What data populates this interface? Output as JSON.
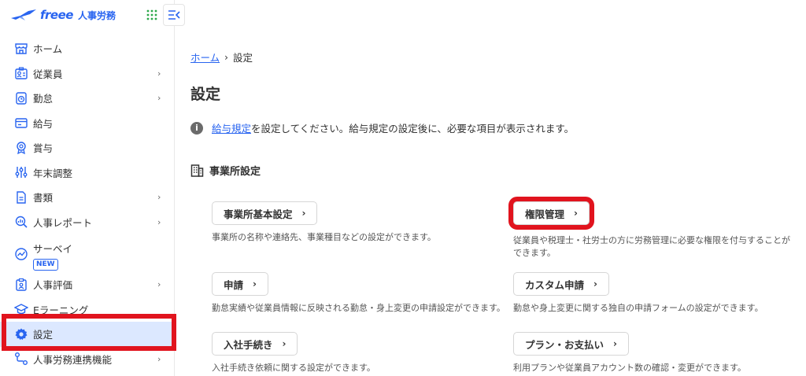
{
  "logo": {
    "brand": "freee",
    "product": "人事労務"
  },
  "sidebar": {
    "items": [
      {
        "label": "ホーム",
        "icon": "storefront-icon",
        "chevron": ""
      },
      {
        "label": "従業員",
        "icon": "employee-id-icon",
        "chevron": "›"
      },
      {
        "label": "勤怠",
        "icon": "clock-icon",
        "chevron": "›"
      },
      {
        "label": "給与",
        "icon": "wallet-icon",
        "chevron": ""
      },
      {
        "label": "賞与",
        "icon": "award-icon",
        "chevron": ""
      },
      {
        "label": "年末調整",
        "icon": "adjust-icon",
        "chevron": ""
      },
      {
        "label": "書類",
        "icon": "document-icon",
        "chevron": "›"
      },
      {
        "label": "人事レポート",
        "icon": "report-icon",
        "chevron": "›"
      },
      {
        "label": "サーベイ",
        "icon": "survey-icon",
        "chevron": "",
        "badge": "NEW"
      },
      {
        "label": "人事評価",
        "icon": "evaluation-icon",
        "chevron": "›"
      },
      {
        "label": "Eラーニング",
        "icon": "graduation-icon",
        "chevron": ""
      },
      {
        "label": "設定",
        "icon": "gear-icon",
        "chevron": ""
      },
      {
        "label": "人事労務連携機能",
        "icon": "integration-icon",
        "chevron": "›"
      }
    ]
  },
  "breadcrumb": {
    "home": "ホーム",
    "sep": "›",
    "current": "設定"
  },
  "page": {
    "title": "設定"
  },
  "notice": {
    "link": "給与規定",
    "text": "を設定してください。給与規定の設定後に、必要な項目が表示されます。"
  },
  "section": {
    "title": "事業所設定"
  },
  "cards": [
    {
      "label": "事業所基本設定",
      "desc": "事業所の名称や連絡先、事業種目などの設定ができます。"
    },
    {
      "label": "権限管理",
      "desc": "従業員や税理士・社労士の方に労務管理に必要な権限を付与することができます。"
    },
    {
      "label": "申請",
      "desc": "勤怠実績や従業員情報に反映される勤怠・身上変更の申請設定ができます。"
    },
    {
      "label": "カスタム申請",
      "desc": "勤怠や身上変更に関する独自の申請フォームの設定ができます。"
    },
    {
      "label": "入社手続き",
      "desc": "入社手続き依頼に関する設定ができます。"
    },
    {
      "label": "プラン・お支払い",
      "desc": "利用プランや従業員アカウント数の確認・変更ができます。"
    }
  ],
  "arrow": "›",
  "colors": {
    "accent": "#2864f0",
    "highlight": "#e1141e",
    "active_bg": "#dce8ff"
  }
}
